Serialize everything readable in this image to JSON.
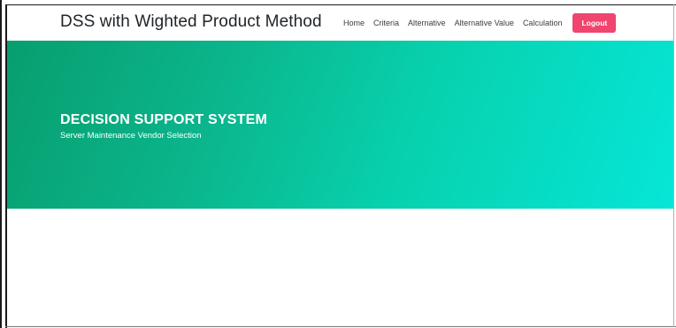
{
  "navbar": {
    "brand": "DSS with Wighted Product Method",
    "links": [
      {
        "label": "Home"
      },
      {
        "label": "Criteria"
      },
      {
        "label": "Alternative"
      },
      {
        "label": "Alternative Value"
      },
      {
        "label": "Calculation"
      }
    ],
    "logout_label": "Logout"
  },
  "hero": {
    "title": "DECISION SUPPORT SYSTEM",
    "subtitle": "Server Maintenance Vendor Selection"
  },
  "colors": {
    "logout_button": "#f0456e",
    "hero_gradient_start": "#079e6f",
    "hero_gradient_end": "#06e6d8"
  }
}
